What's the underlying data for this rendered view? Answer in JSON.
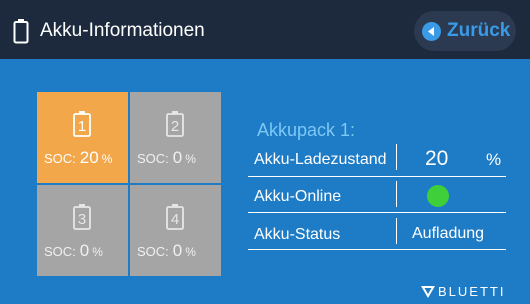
{
  "header": {
    "title": "Akku-Informationen",
    "back_label": "Zurück",
    "icons": {
      "title_icon": "battery-outline-icon",
      "back_icon": "arrow-left-icon"
    }
  },
  "packs": [
    {
      "number": "1",
      "soc_label": "SOC:",
      "soc_value": "20",
      "unit": "%",
      "active": true
    },
    {
      "number": "2",
      "soc_label": "SOC:",
      "soc_value": "0",
      "unit": "%",
      "active": false
    },
    {
      "number": "3",
      "soc_label": "SOC:",
      "soc_value": "0",
      "unit": "%",
      "active": false
    },
    {
      "number": "4",
      "soc_label": "SOC:",
      "soc_value": "0",
      "unit": "%",
      "active": false
    }
  ],
  "details": {
    "title": "Akkupack 1:",
    "soc_label": "Akku-Ladezustand",
    "soc_value": "20",
    "soc_unit": "%",
    "online_label": "Akku-Online",
    "online_status_color": "#3ecf3a",
    "status_label": "Akku-Status",
    "status_value": "Aufladung"
  },
  "brand": {
    "name": "BLUETTI"
  },
  "colors": {
    "background": "#1e7bc6",
    "header": "#1d2a3d",
    "active_tile": "#f2a74b",
    "inactive_tile": "#a5a5a5",
    "accent": "#3a9ae6"
  }
}
